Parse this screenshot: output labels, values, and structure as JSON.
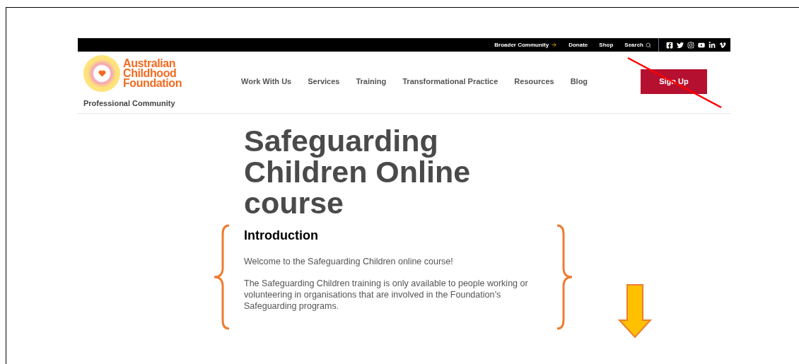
{
  "top_bar": {
    "links": [
      "Broader Community",
      "Donate",
      "Shop",
      "Search"
    ]
  },
  "logo": {
    "name_lines": [
      "Australian",
      "Childhood",
      "Foundation"
    ],
    "subtitle": "Professional Community"
  },
  "nav": {
    "items": [
      "Work With Us",
      "Services",
      "Training",
      "Transformational Practice",
      "Resources",
      "Blog"
    ],
    "button": "Sign Up"
  },
  "page": {
    "title": "Safeguarding Children Online course",
    "section_heading": "Introduction",
    "paragraphs": [
      "Welcome to the Safeguarding Children online course!",
      "The Safeguarding Children training is only available to people working or volunteering in organisations that are involved in the Foundation’s Safeguarding programs."
    ]
  }
}
